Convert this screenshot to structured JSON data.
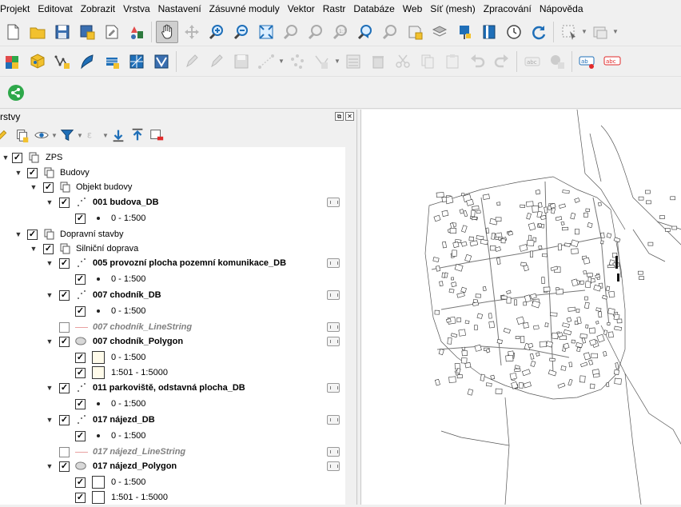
{
  "menu": [
    {
      "label": "Projekt"
    },
    {
      "label": "Editovat"
    },
    {
      "label": "Zobrazit"
    },
    {
      "label": "Vrstva"
    },
    {
      "label": "Nastavení"
    },
    {
      "label": "Zásuvné moduly"
    },
    {
      "label": "Vektor"
    },
    {
      "label": "Rastr"
    },
    {
      "label": "Databáze"
    },
    {
      "label": "Web"
    },
    {
      "label": "Síť (mesh)"
    },
    {
      "label": "Zpracování"
    },
    {
      "label": "Nápověda"
    }
  ],
  "layers_panel": {
    "title": "rstvy",
    "float_glyph": "⧉",
    "close_glyph": "✕"
  },
  "tree": {
    "check": "✓",
    "expand": "▼",
    "zps": "ZPS",
    "budovy": "Budovy",
    "objekt_budovy": "Objekt budovy",
    "l001": "001 budova_DB",
    "l001_r1": "0 - 1:500",
    "dopravni": "Dopravní stavby",
    "silnicni": "Silniční doprava",
    "l005": "005 provozní plocha pozemní komunikace_DB",
    "l005_r1": "0 - 1:500",
    "l007": "007 chodník_DB",
    "l007_r1": "0 - 1:500",
    "l007_ls": "007 chodník_LineString",
    "l007_poly": "007 chodník_Polygon",
    "l007_poly_r1": "0 - 1:500",
    "l007_poly_r2": "1:501 - 1:5000",
    "l011": "011 parkoviště, odstavná plocha_DB",
    "l011_r1": "0 - 1:500",
    "l017": "017 nájezd_DB",
    "l017_r1": "0 - 1:500",
    "l017_ls": "017 nájezd_LineString",
    "l017_poly": "017 nájezd_Polygon",
    "l017_poly_r1": "0 - 1:500",
    "l017_poly_r2": "1:501 - 1:5000"
  },
  "colors": {
    "accent_green": "#2ea84a",
    "icon_blue": "#1f6fb8",
    "icon_yellow": "#f2c12e"
  }
}
